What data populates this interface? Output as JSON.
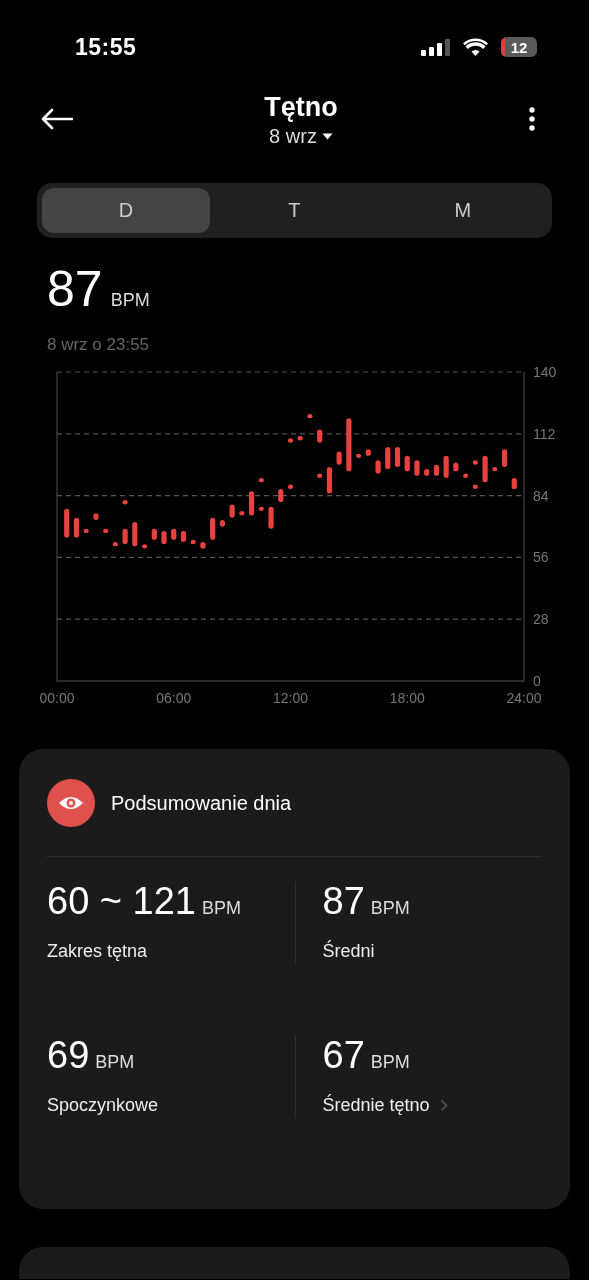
{
  "status_bar": {
    "time": "15:55",
    "battery": "12"
  },
  "header": {
    "title": "Tętno",
    "date": "8 wrz"
  },
  "tabs": [
    {
      "label": "D",
      "selected": true
    },
    {
      "label": "T",
      "selected": false
    },
    {
      "label": "M",
      "selected": false
    }
  ],
  "current": {
    "value": "87",
    "unit": "BPM",
    "timestamp": "8 wrz o 23:55"
  },
  "chart": {
    "y_labels": [
      "140",
      "112",
      "84",
      "56",
      "28",
      "0"
    ],
    "x_labels": [
      "00:00",
      "06:00",
      "12:00",
      "18:00",
      "24:00"
    ]
  },
  "summary": {
    "title": "Podsumowanie dnia",
    "stats": [
      {
        "value": "60 ~ 121",
        "unit": "BPM",
        "label": "Zakres tętna",
        "link": false
      },
      {
        "value": "87",
        "unit": "BPM",
        "label": "Średni",
        "link": false
      },
      {
        "value": "69",
        "unit": "BPM",
        "label": "Spoczynkowe",
        "link": false
      },
      {
        "value": "67",
        "unit": "BPM",
        "label": "Średnie tętno",
        "link": true
      }
    ]
  }
}
